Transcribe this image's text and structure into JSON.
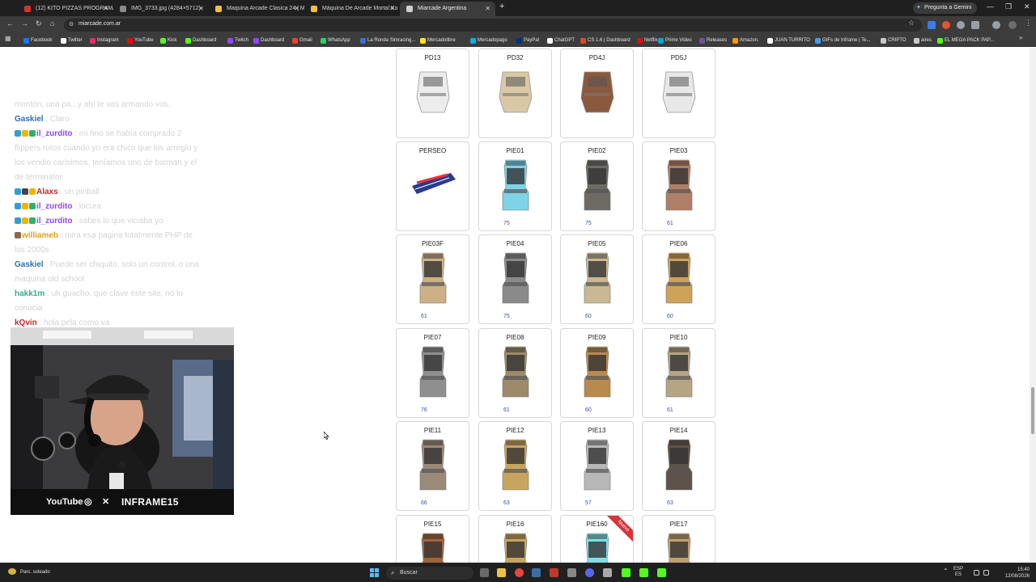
{
  "browser": {
    "tabs": [
      {
        "label": "(12) KITO PIZZAS PROGRAMA",
        "active": false,
        "favicon_color": "#e02f2f"
      },
      {
        "label": "IMG_3733.jpg (4284×5712)",
        "active": false,
        "favicon_color": "#8a8a8a"
      },
      {
        "label": "Maquina Arcade Clasica 24 | M",
        "active": false,
        "favicon_color": "#f0c13a"
      },
      {
        "label": "Máquina De Arcade Mortal Ko",
        "active": false,
        "favicon_color": "#f0c13a"
      },
      {
        "label": "Miarcade Argentina",
        "active": true,
        "favicon_color": "#cfcfcf"
      }
    ],
    "gemini_label": "Pregunta a Gemini",
    "url": "miarcade.com.ar"
  },
  "bookmarks": [
    {
      "label": "Facebook",
      "color": "#1877f2"
    },
    {
      "label": "Twitter",
      "color": "#ffffff"
    },
    {
      "label": "Instagram",
      "color": "#e1306c"
    },
    {
      "label": "YouTube",
      "color": "#ff0000"
    },
    {
      "label": "Kick",
      "color": "#53fc18"
    },
    {
      "label": "Dashboard",
      "color": "#53fc18"
    },
    {
      "label": "Twitch",
      "color": "#9146ff"
    },
    {
      "label": "Dashboard",
      "color": "#9146ff"
    },
    {
      "label": "Gmail",
      "color": "#ea4335"
    },
    {
      "label": "WhatsApp",
      "color": "#25d366"
    },
    {
      "label": "La Ronda Simracing...",
      "color": "#3a6fd8"
    },
    {
      "label": "Mercadolibre",
      "color": "#ffe600"
    },
    {
      "label": "Mercadopago",
      "color": "#00b1ea"
    },
    {
      "label": "PayPal",
      "color": "#003087"
    },
    {
      "label": "ChatGPT",
      "color": "#ffffff"
    },
    {
      "label": "CS 1.6 | Dashboard",
      "color": "#d94a2a"
    },
    {
      "label": "Netflix",
      "color": "#e50914"
    },
    {
      "label": "Prime Video",
      "color": "#00a8e1"
    },
    {
      "label": "Releases",
      "color": "#6e5494"
    },
    {
      "label": "Amazon.",
      "color": "#ff9900"
    },
    {
      "label": "JUAN TURRITO",
      "color": "#ffffff"
    },
    {
      "label": "GIFs de Inframe | Te...",
      "color": "#3aa0ff"
    },
    {
      "label": "CRIPTO",
      "color": "#c9c9c9"
    },
    {
      "label": "aires",
      "color": "#c9c9c9"
    },
    {
      "label": "EL MEGA PACK PAP...",
      "color": "#53fc18"
    }
  ],
  "products": [
    {
      "name": "PD13",
      "number": "",
      "color": "#ececec"
    },
    {
      "name": "PD32",
      "number": "",
      "color": "#d9c7a6"
    },
    {
      "name": "PD4J",
      "number": "",
      "color": "#8b5a3c"
    },
    {
      "name": "PD5J",
      "number": "",
      "color": "#e8e8e8"
    },
    {
      "name": "PERSEO",
      "number": "",
      "color": "#2a3a8f"
    },
    {
      "name": "PIE01",
      "number": "75",
      "color": "#7fd3e6"
    },
    {
      "name": "PIE02",
      "number": "75",
      "color": "#6e6a64"
    },
    {
      "name": "PIE03",
      "number": "61",
      "color": "#b07f68"
    },
    {
      "name": "PIE03F",
      "number": "61",
      "color": "#cdb085"
    },
    {
      "name": "PIE04",
      "number": "75",
      "color": "#8a8a8a"
    },
    {
      "name": "PIE05",
      "number": "60",
      "color": "#c9b892"
    },
    {
      "name": "PIE06",
      "number": "60",
      "color": "#cfa25a"
    },
    {
      "name": "PIE07",
      "number": "76",
      "color": "#8f8f8f"
    },
    {
      "name": "PIE08",
      "number": "61",
      "color": "#9c8a6a"
    },
    {
      "name": "PIE09",
      "number": "60",
      "color": "#b98a4e"
    },
    {
      "name": "PIE10",
      "number": "61",
      "color": "#b6a585"
    },
    {
      "name": "PIE11",
      "number": "66",
      "color": "#9a8a7a"
    },
    {
      "name": "PIE12",
      "number": "63",
      "color": "#c8a55f"
    },
    {
      "name": "PIE13",
      "number": "57",
      "color": "#b8b8b8"
    },
    {
      "name": "PIE14",
      "number": "63",
      "color": "#5e534a"
    },
    {
      "name": "PIE15",
      "number": "",
      "color": "#a0633a"
    },
    {
      "name": "PIE16",
      "number": "",
      "color": "#c8a55f"
    },
    {
      "name": "PIE160",
      "number": "",
      "color": "#7fe0e6",
      "ribbon": "Nuevo"
    },
    {
      "name": "PIE17",
      "number": "",
      "color": "#c0a070"
    }
  ],
  "chat": [
    {
      "user": "",
      "user_color": "#ffffff",
      "badges": [],
      "message": "montón, una pa...y ahí te vas armando vos."
    },
    {
      "user": "Gaskiel",
      "user_color": "#2f6fb5",
      "badges": [],
      "message": ": Claro"
    },
    {
      "user": "il_zurdito",
      "user_color": "#9146ff",
      "badges": [
        "#2f9fd6",
        "#f0b400",
        "#2fb070"
      ],
      "message": ": mi hno se había comprado 2 flippers rotos cuando yo era chico que los arreglo y los vendio carísimos, teníamos uno de batman y el de terminator"
    },
    {
      "user": "Alaxs",
      "user_color": "#c42a2a",
      "badges": [
        "#2f9fd6",
        "#444444",
        "#f0b400"
      ],
      "message": ": un pinball"
    },
    {
      "user": "il_zurdito",
      "user_color": "#9146ff",
      "badges": [
        "#2f9fd6",
        "#f0b400",
        "#2fb070"
      ],
      "message": ": locura"
    },
    {
      "user": "il_zurdito",
      "user_color": "#9146ff",
      "badges": [
        "#2f9fd6",
        "#f0b400",
        "#2fb070"
      ],
      "message": ": sabes lo que viciaba yo"
    },
    {
      "user": "williameb",
      "user_color": "#e0a020",
      "badges": [
        "#8a6a4a"
      ],
      "message": ": mira esa pagina totalmente PHP de los 2000s"
    },
    {
      "user": "Gaskiel",
      "user_color": "#2f6fb5",
      "badges": [],
      "message": ": Puede ser chiquito, solo un control, o una maquina old school"
    },
    {
      "user": "hakk1m",
      "user_color": "#2fae8f",
      "badges": [],
      "message": ": uh guacho, que clave este site, no lo conocia"
    },
    {
      "user": "kQvin",
      "user_color": "#c42a2a",
      "badges": [],
      "message": ": hola pela como va"
    }
  ],
  "webcam": {
    "youtube_label": "YouTube",
    "instagram_icon": "instagram-icon",
    "twitter_icon": "twitter-icon",
    "handle": "INFRAME15"
  },
  "taskbar": {
    "weather": "Parc. soleado",
    "search_placeholder": "Buscar",
    "lang_top": "ESP",
    "lang_bottom": "ES",
    "time": "15:40",
    "date": "12/08/2026"
  }
}
